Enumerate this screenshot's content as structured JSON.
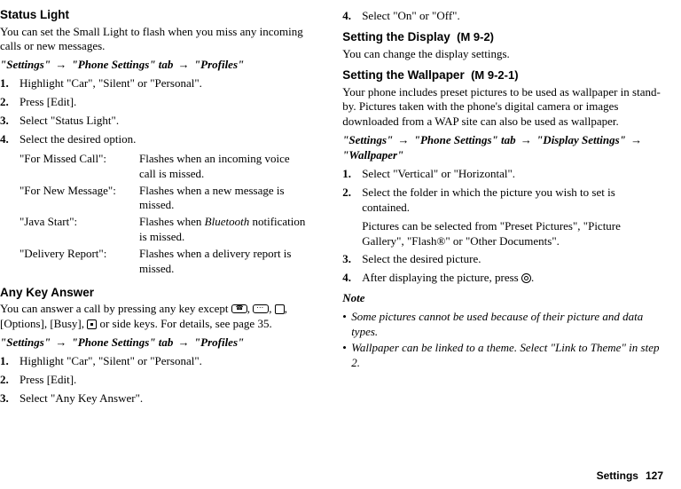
{
  "left": {
    "statusLight": {
      "heading": "Status Light",
      "intro": "You can set the Small Light to flash when you miss any incoming calls or new messages.",
      "path": {
        "a": "\"Settings\"",
        "b": "\"Phone Settings\" tab",
        "c": "\"Profiles\""
      },
      "steps": {
        "s1": "Highlight \"Car\", \"Silent\" or \"Personal\".",
        "s2": "Press [Edit].",
        "s3": "Select \"Status Light\".",
        "s4": "Select the desired option."
      },
      "opts": {
        "t1": "\"For Missed Call\":",
        "d1": "Flashes when an incoming voice call is missed.",
        "t2": "\"For New Message\":",
        "d2": "Flashes when a new message is missed.",
        "t3": "\"Java Start\":",
        "d3a": "Flashes when ",
        "d3b": "Bluetooth",
        "d3c": " notification is missed.",
        "t4": "\"Delivery Report\":",
        "d4": "Flashes when a delivery report is missed."
      }
    },
    "anyKey": {
      "heading": "Any Key Answer",
      "introA": "You can answer a call by pressing any key except ",
      "introB": ", [Options], [Busy], ",
      "introC": " or side keys. For details, see page 35.",
      "path": {
        "a": "\"Settings\"",
        "b": "\"Phone Settings\" tab",
        "c": "\"Profiles\""
      },
      "steps": {
        "s1": "Highlight \"Car\", \"Silent\" or \"Personal\".",
        "s2": "Press [Edit].",
        "s3": "Select \"Any Key Answer\"."
      }
    }
  },
  "right": {
    "cont": {
      "s4": "Select \"On\" or \"Off\"."
    },
    "display": {
      "heading": "Setting the Display",
      "code": "(M 9-2)",
      "intro": "You can change the display settings."
    },
    "wallpaper": {
      "heading": "Setting the Wallpaper",
      "code": "(M 9-2-1)",
      "intro": "Your phone includes preset pictures to be used as wallpaper in stand-by. Pictures taken with the phone's digital camera or images downloaded from a WAP site can also be used as wallpaper.",
      "path": {
        "a": "\"Settings\"",
        "b": "\"Phone Settings\" tab",
        "c": "\"Display Settings\"",
        "d": "\"Wallpaper\""
      },
      "steps": {
        "s1": "Select \"Vertical\" or \"Horizontal\".",
        "s2": "Select the folder in which the picture you wish to set is contained.",
        "s2b": "Pictures can be selected from \"Preset Pictures\", \"Picture Gallery\", \"Flash®\" or \"Other Documents\".",
        "s3": "Select the desired picture.",
        "s4a": "After displaying the picture, press ",
        "s4b": "."
      },
      "noteHd": "Note",
      "notes": {
        "n1": "Some pictures cannot be used because of their picture and data types.",
        "n2": "Wallpaper can be linked to a theme. Select \"Link to Theme\" in step 2."
      }
    }
  },
  "nums": {
    "n1": "1.",
    "n2": "2.",
    "n3": "3.",
    "n4": "4."
  },
  "arrow": "→",
  "bullet": "•",
  "comma": ", ",
  "footer": {
    "label": "Settings",
    "page": "127"
  }
}
